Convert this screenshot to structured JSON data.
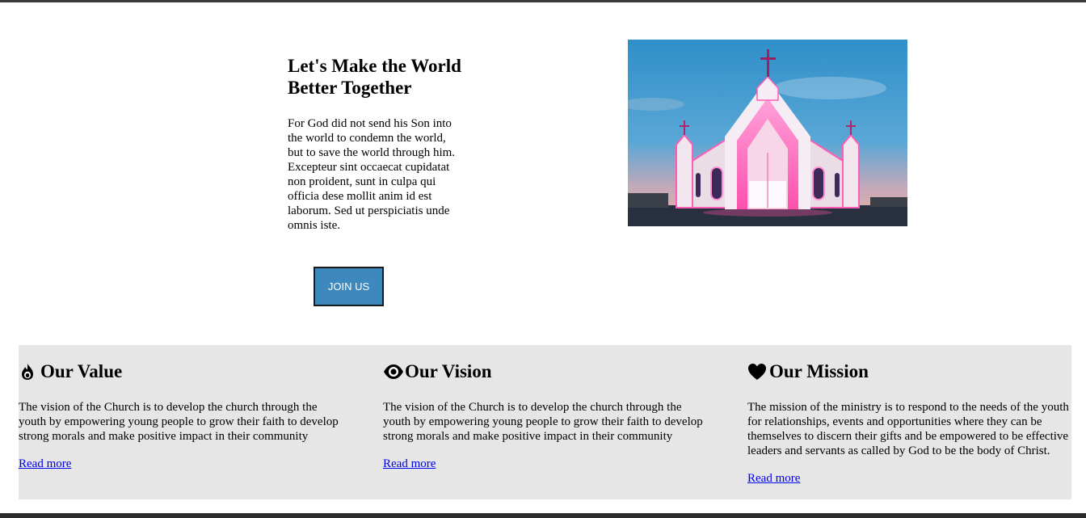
{
  "hero": {
    "title": "Let's Make the World Better Together",
    "body": "For God did not send his Son into the world to condemn the world, but to save the world through him. Excepteur sint occaecat cupidatat non proident, sunt in culpa qui officia dese mollit anim id est laborum. Sed ut perspiciatis unde omnis iste.",
    "button_label": "JOIN US",
    "button_color": "#3d89bd",
    "image": "church-illuminated-pink-photo"
  },
  "features": [
    {
      "icon": "fire-icon",
      "title": "Our Value",
      "body": "The vision of the Church is to develop the church through the youth by empowering young people to grow their faith to develop strong morals and make positive impact in their community",
      "link": "Read more"
    },
    {
      "icon": "eye-icon",
      "title": "Our Vision",
      "body": "The vision of the Church is to develop the church through the youth by empowering young people to grow their faith to develop strong morals and make positive impact in their community",
      "link": "Read more"
    },
    {
      "icon": "heart-icon",
      "title": "Our Mission",
      "body": "The mission of the ministry is to respond to the needs of the youth for relationships, events and opportunities where they can be themselves to discern their gifts and be empowered to be effective leaders and servants as called by God to be the body of Christ.",
      "link": "Read more"
    }
  ],
  "colors": {
    "feature_background": "#e6e6e6",
    "link": "#0000ee"
  }
}
